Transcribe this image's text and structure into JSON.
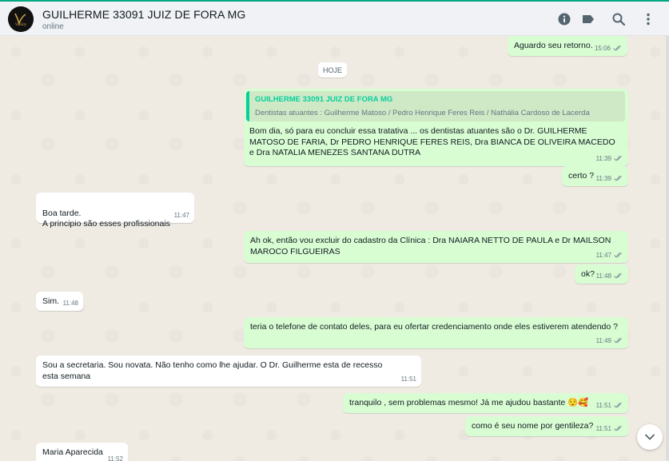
{
  "header": {
    "contact_name": "GUILHERME 33091 JUIZ DE FORA MG",
    "status": "online",
    "avatar_text": "Vitality",
    "icons": [
      "info-icon",
      "label-icon",
      "search-icon",
      "more-vertical-icon"
    ]
  },
  "day_separator": "HOJE",
  "messages": [
    {
      "dir": "out",
      "text": "Aguardo seu retorno.",
      "time": "15:06"
    },
    {
      "dir": "out",
      "quote_title": "GUILHERME 33091 JUIZ DE FORA MG",
      "quote_body": "Dentistas atuantes : Guilherme Matoso   / Pedro Henrique Feres Reis    / Nathália Cardoso de Lacerda",
      "text": "Bom dia, só para eu concluir essa tratativa ... os dentistas atuantes são o Dr. GUILHERME MATOSO DE FARIA, Dr PEDRO HENRIQUE FERES REIS, Dra BIANCA DE OLIVEIRA MACEDO e Dra NATALIA MENEZES SANTANA DUTRA",
      "time": "11:39"
    },
    {
      "dir": "out",
      "text": "certo ?",
      "time": "11:39"
    },
    {
      "dir": "in",
      "text": "Boa tarde.\nA principio são esses profissionais",
      "time": "11:47"
    },
    {
      "dir": "out",
      "text": "Ah ok, então vou excluir do cadastro da Clínica : Dra NAIARA NETTO DE PAULA e Dr MAILSON MAROCO FILGUEIRAS",
      "time": "11:47"
    },
    {
      "dir": "out",
      "text": "ok?",
      "time": "11:48"
    },
    {
      "dir": "in",
      "text": "Sim.",
      "time": "11:48"
    },
    {
      "dir": "out",
      "text": "teria o telefone de contato deles, para eu ofertar credenciamento onde eles estiverem atendendo ?",
      "time": "11:49"
    },
    {
      "dir": "in",
      "text": "Sou a secretaria. Sou novata. Não tenho como lhe ajudar. O Dr. Guilherme esta de recesso esta semana",
      "time": "11:51"
    },
    {
      "dir": "out",
      "text": "tranquilo , sem problemas mesmo! Já me ajudou bastante 😌🥰",
      "time": "11:51"
    },
    {
      "dir": "out",
      "text": "como é seu nome por gentileza?",
      "time": "11:51"
    },
    {
      "dir": "in",
      "text": "Maria Aparecida",
      "time": "11:52"
    }
  ],
  "colors": {
    "outgoing_bubble": "#d9fdd3",
    "incoming_bubble": "#ffffff",
    "accent": "#00a884",
    "read_ticks": "#53bdeb"
  }
}
